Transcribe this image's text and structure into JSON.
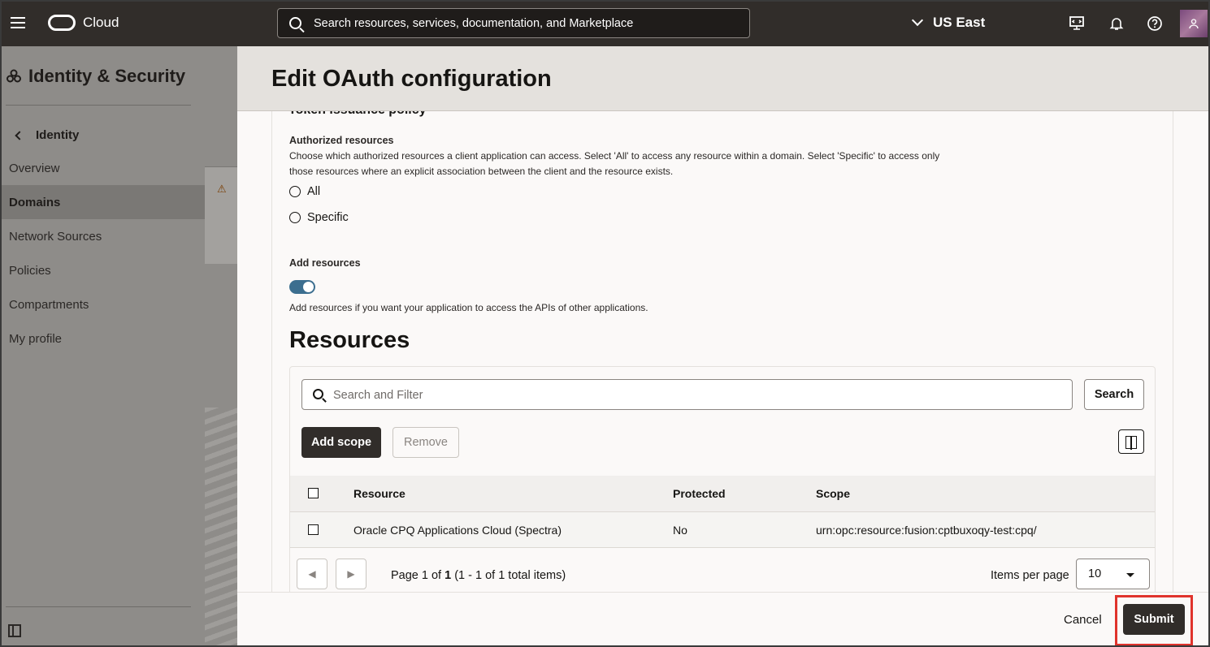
{
  "topbar": {
    "brand": "Cloud",
    "search_placeholder": "Search resources, services, documentation, and Marketplace",
    "region": "US East",
    "icons": [
      "menu-icon",
      "oracle-logo",
      "search-icon",
      "chevron-down-icon",
      "developer-tools-icon",
      "bell-icon",
      "help-icon",
      "user-avatar"
    ]
  },
  "sidebar": {
    "title": "Identity & Security",
    "back_label": "Identity",
    "items": [
      {
        "label": "Overview",
        "active": false
      },
      {
        "label": "Domains",
        "active": true
      },
      {
        "label": "Network Sources",
        "active": false
      },
      {
        "label": "Policies",
        "active": false
      },
      {
        "label": "Compartments",
        "active": false
      },
      {
        "label": "My profile",
        "active": false
      }
    ]
  },
  "panel": {
    "title": "Edit OAuth configuration",
    "cut_heading": "Token issuance policy",
    "authorized_resources": {
      "label": "Authorized resources",
      "help": "Choose which authorized resources a client application can access. Select 'All' to access any resource within a domain. Select 'Specific' to access only those resources where an explicit association between the client and the resource exists.",
      "options": [
        "All",
        "Specific"
      ]
    },
    "add_resources": {
      "label": "Add resources",
      "toggle_on": true,
      "help": "Add resources if you want your application to access the APIs of other applications."
    },
    "resources": {
      "title": "Resources",
      "filter_placeholder": "Search and Filter",
      "search_button": "Search",
      "add_scope_button": "Add scope",
      "remove_button": "Remove",
      "columns": [
        "Resource",
        "Protected",
        "Scope"
      ],
      "rows": [
        {
          "resource": "Oracle CPQ Applications Cloud (Spectra)",
          "protected": "No",
          "scope": "urn:opc:resource:fusion:cptbuxoqy-test:cpq/"
        }
      ],
      "pagination": {
        "page_prefix": "Page 1 of",
        "total_pages": "1",
        "range_text": "(1 - 1 of 1 total items)",
        "items_per_page_label": "Items per page",
        "items_per_page": "10"
      }
    },
    "footer": {
      "cancel": "Cancel",
      "submit": "Submit"
    }
  },
  "colors": {
    "topbar": "#312d2a",
    "toggle_on": "#3c6e8f",
    "highlight": "#e0332c"
  }
}
